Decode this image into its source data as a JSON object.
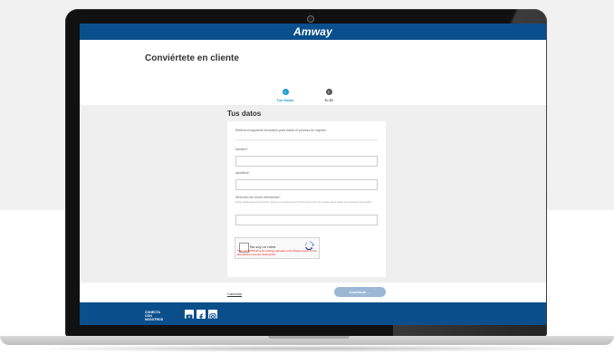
{
  "site": {
    "logo": "Amway"
  },
  "header": {
    "title": "Conviértete en cliente"
  },
  "steps": [
    {
      "number": "1",
      "label": "Tus Datos",
      "active": true
    },
    {
      "number": "2",
      "label": "Tu ID",
      "active": false
    }
  ],
  "form": {
    "section_title": "Tus datos",
    "intro": "Rellena el siguiente formulario para iniciar el proceso de registro.",
    "fields": {
      "nombre": {
        "label": "Nombre*",
        "value": ""
      },
      "apellidos": {
        "label": "Apellidos*",
        "value": ""
      },
      "email": {
        "label": "Dirección de correo electrónico*",
        "help": "Debe cada persona inscrita, tienes tu e-mail que el nombre de inicio de sesión para todas tus cuentas de Amway.",
        "value": ""
      }
    },
    "captcha": {
      "label": "No soy un robot",
      "brand": "reCAPTCHA",
      "error": "This reCAPTCHA is for testing purposes only. Please report to the site admin if you are seeing this."
    }
  },
  "actions": {
    "cancel": "Cancelar",
    "continue": "Continuar →"
  },
  "footer": {
    "connect": "CONECTA CON NOSOTROS",
    "social_icons": [
      "youtube-icon",
      "facebook-icon",
      "instagram-icon"
    ]
  },
  "colors": {
    "brand_blue": "#0a4f8c",
    "step_active": "#1b9ad6",
    "step_inactive": "#555555",
    "button_disabled": "#9ab8d4"
  }
}
